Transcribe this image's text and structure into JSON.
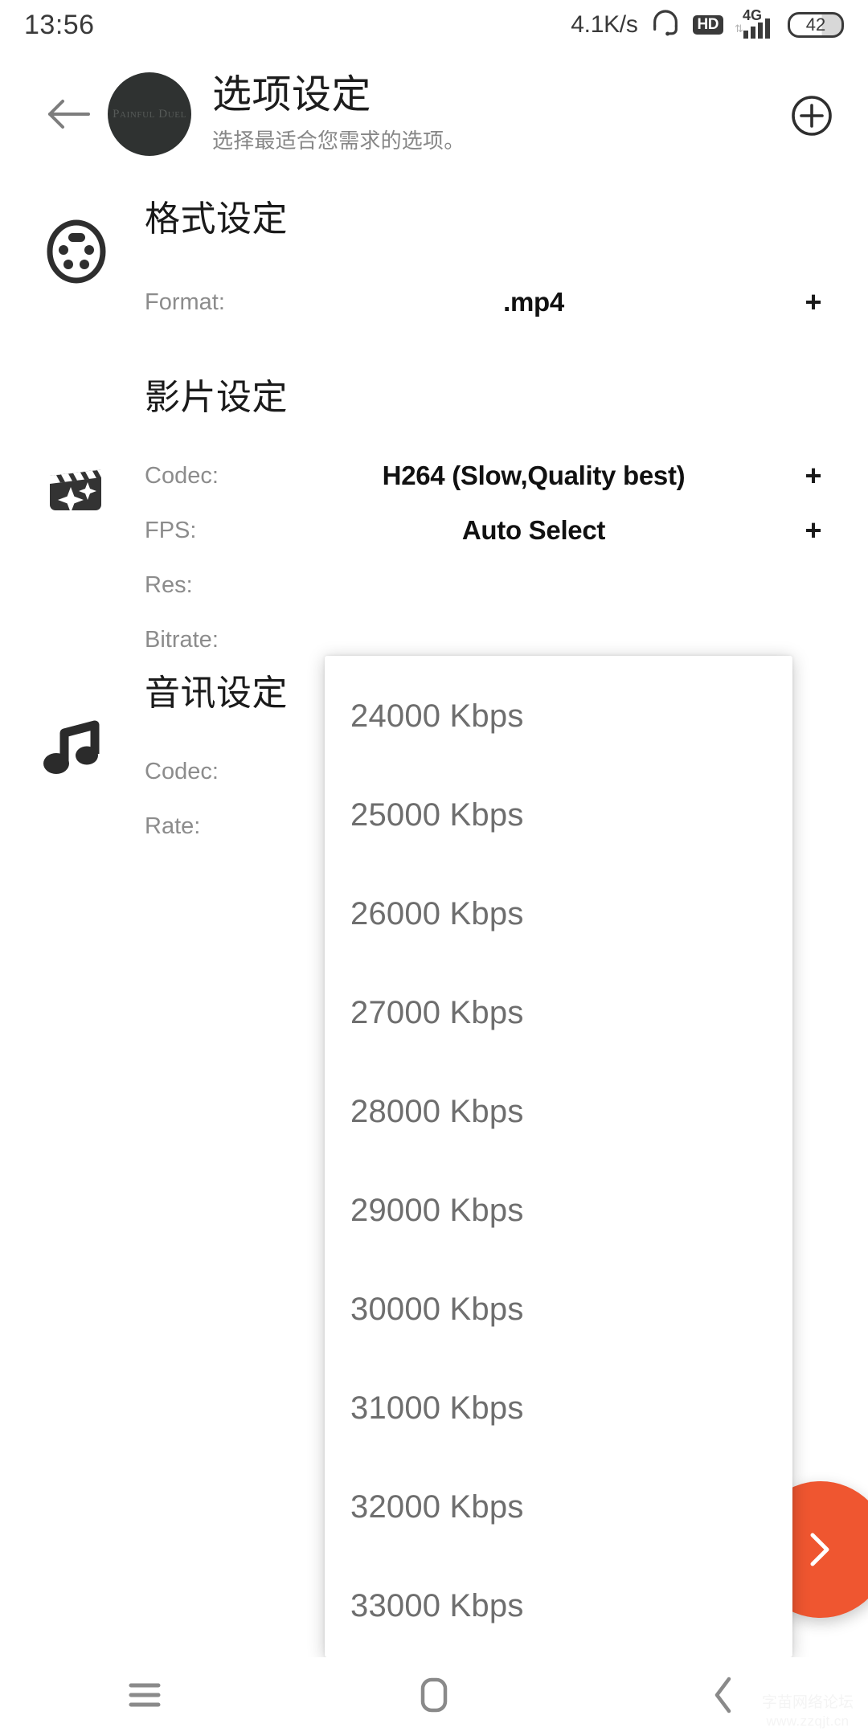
{
  "status_bar": {
    "clock": "13:56",
    "net_speed": "4.1K/s",
    "headset_icon": "headset-icon",
    "hd_badge": "HD",
    "network_type": "4G",
    "signal_icon": "signal-bars-icon",
    "battery_level": "42"
  },
  "app_bar": {
    "back_icon": "back-arrow-icon",
    "avatar_label": "Painful Duel",
    "title": "选项设定",
    "subtitle": "选择最适合您需求的选项。",
    "action_icon": "add-circle-icon"
  },
  "sections": [
    {
      "id": "format",
      "icon": "svideo-connector-icon",
      "title": "格式设定",
      "rows": [
        {
          "label": "Format:",
          "value": ".mp4",
          "action": "+"
        }
      ]
    },
    {
      "id": "video",
      "icon": "clapperboard-sparkle-icon",
      "title": "影片设定",
      "rows": [
        {
          "label": "Codec:",
          "value": "H264 (Slow,Quality best)",
          "action": "+"
        },
        {
          "label": "FPS:",
          "value": "Auto Select",
          "action": "+"
        },
        {
          "label": "Res:",
          "value": "",
          "action": ""
        },
        {
          "label": "Bitrate:",
          "value": "",
          "action": ""
        }
      ]
    },
    {
      "id": "audio",
      "icon": "music-note-icon",
      "title": "音讯设定",
      "rows": [
        {
          "label": "Codec:",
          "value": "",
          "action": ""
        },
        {
          "label": "Rate:",
          "value": "",
          "action": ""
        }
      ]
    }
  ],
  "dropdown": {
    "name": "bitrate-options-dropdown",
    "items": [
      "24000 Kbps",
      "25000 Kbps",
      "26000 Kbps",
      "27000 Kbps",
      "28000 Kbps",
      "29000 Kbps",
      "30000 Kbps",
      "31000 Kbps",
      "32000 Kbps",
      "33000 Kbps"
    ]
  },
  "fab": {
    "icon": "chevron-right-icon",
    "color": "#ef5630"
  },
  "nav_bar": {
    "recents_icon": "menu-icon",
    "home_icon": "home-square-icon",
    "back_icon": "back-chevron-icon"
  },
  "watermark": {
    "line1": "字苗网络论坛",
    "line2": "www.zzqjt.cn"
  },
  "colors": {
    "accent": "#ef5630",
    "text_primary": "#1a1a1a",
    "text_secondary": "#8c8c8c",
    "avatar_bg": "#2f3231",
    "background": "#ffffff"
  }
}
